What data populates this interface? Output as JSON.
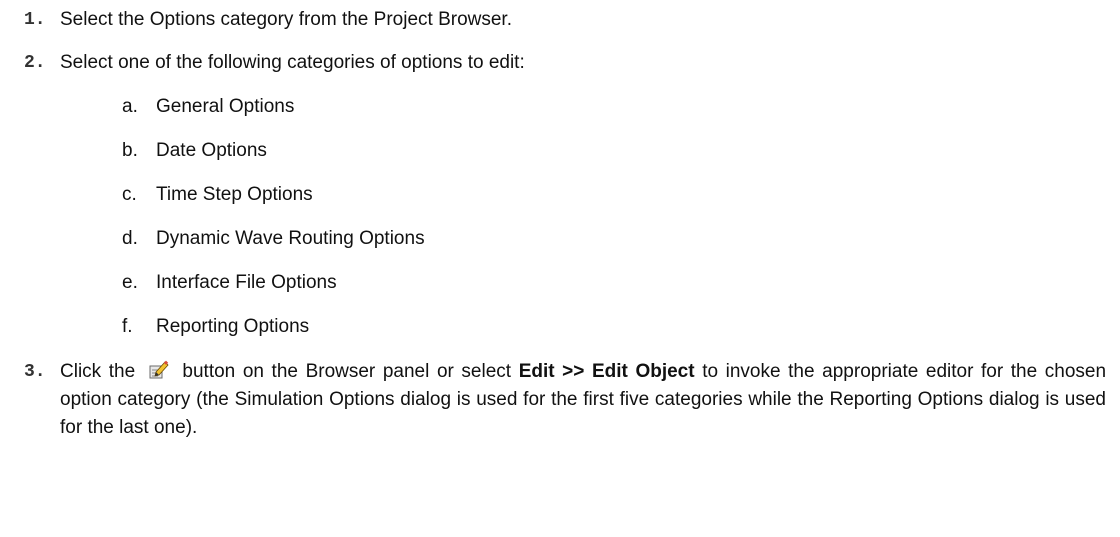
{
  "steps": [
    {
      "num": "1.",
      "text": "Select the Options category from the Project Browser."
    },
    {
      "num": "2.",
      "text": "Select one of the following categories of options to edit:"
    },
    {
      "num": "3.",
      "pre": "Click the",
      "post1": "button on the Browser panel or select",
      "bold": "Edit >> Edit Object",
      "post2": "to invoke the appropriate editor for the chosen option category (the Simulation Options dialog is used for the first five categories while the Reporting Options dialog is used for the last one)."
    }
  ],
  "substeps": [
    {
      "letter": "a.",
      "label": "General Options"
    },
    {
      "letter": "b.",
      "label": "Date Options"
    },
    {
      "letter": "c.",
      "label": "Time Step Options"
    },
    {
      "letter": "d.",
      "label": "Dynamic Wave Routing Options"
    },
    {
      "letter": "e.",
      "label": "Interface File Options"
    },
    {
      "letter": "f.",
      "label": "Reporting Options"
    }
  ],
  "icons": {
    "edit_button": "edit-object-icon"
  }
}
